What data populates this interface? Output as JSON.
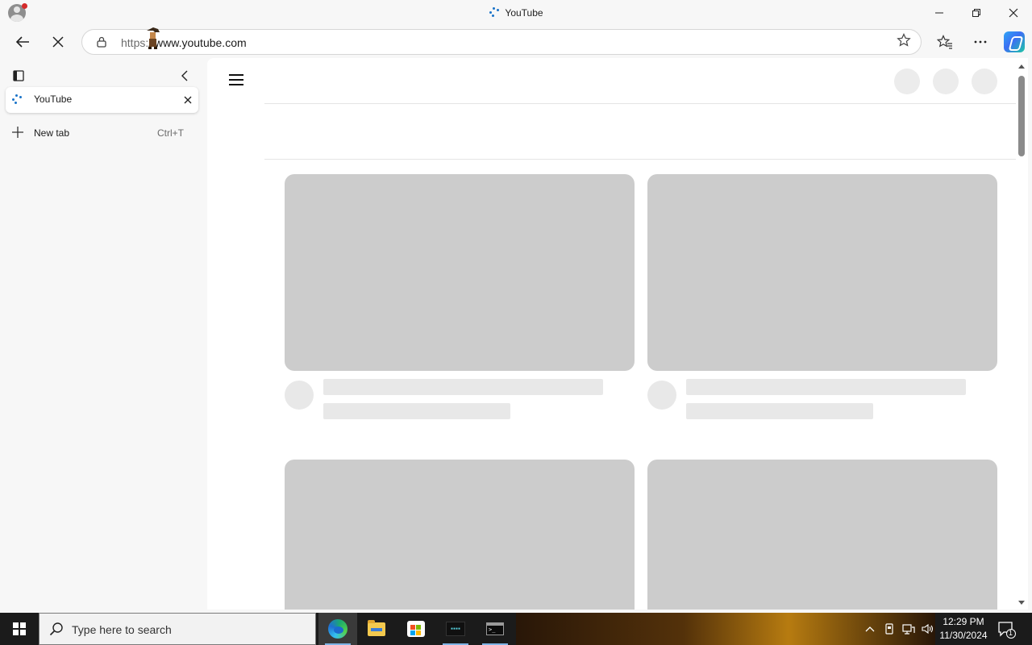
{
  "window": {
    "title": "YouTube",
    "minimize_icon": "minimize-icon",
    "restore_icon": "restore-icon",
    "close_icon": "close-icon"
  },
  "toolbar": {
    "url_protocol": "https://",
    "url_host": "www.youtube.com",
    "back_icon": "back-arrow-icon",
    "stop_icon": "stop-loading-icon",
    "favorite_icon": "star-icon",
    "collections_icon": "favorites-icon",
    "menu_icon": "more-icon",
    "copilot_icon": "copilot-icon"
  },
  "sidepanel": {
    "tabs": [
      {
        "label": "YouTube",
        "loading": true
      }
    ],
    "new_tab_label": "New tab",
    "new_tab_shortcut": "Ctrl+T"
  },
  "taskbar": {
    "search_placeholder": "Type here to search",
    "apps": [
      "edge-icon",
      "file-explorer-icon",
      "microsoft-store-icon",
      "dark-app-icon",
      "terminal-icon"
    ],
    "clock_time": "12:29 PM",
    "clock_date": "11/30/2024",
    "notification_count": "1"
  },
  "colors": {
    "skeleton_thumb": "#cccccc",
    "skeleton_text": "#e8e8e8",
    "loading_accent": "#1a73c9"
  }
}
